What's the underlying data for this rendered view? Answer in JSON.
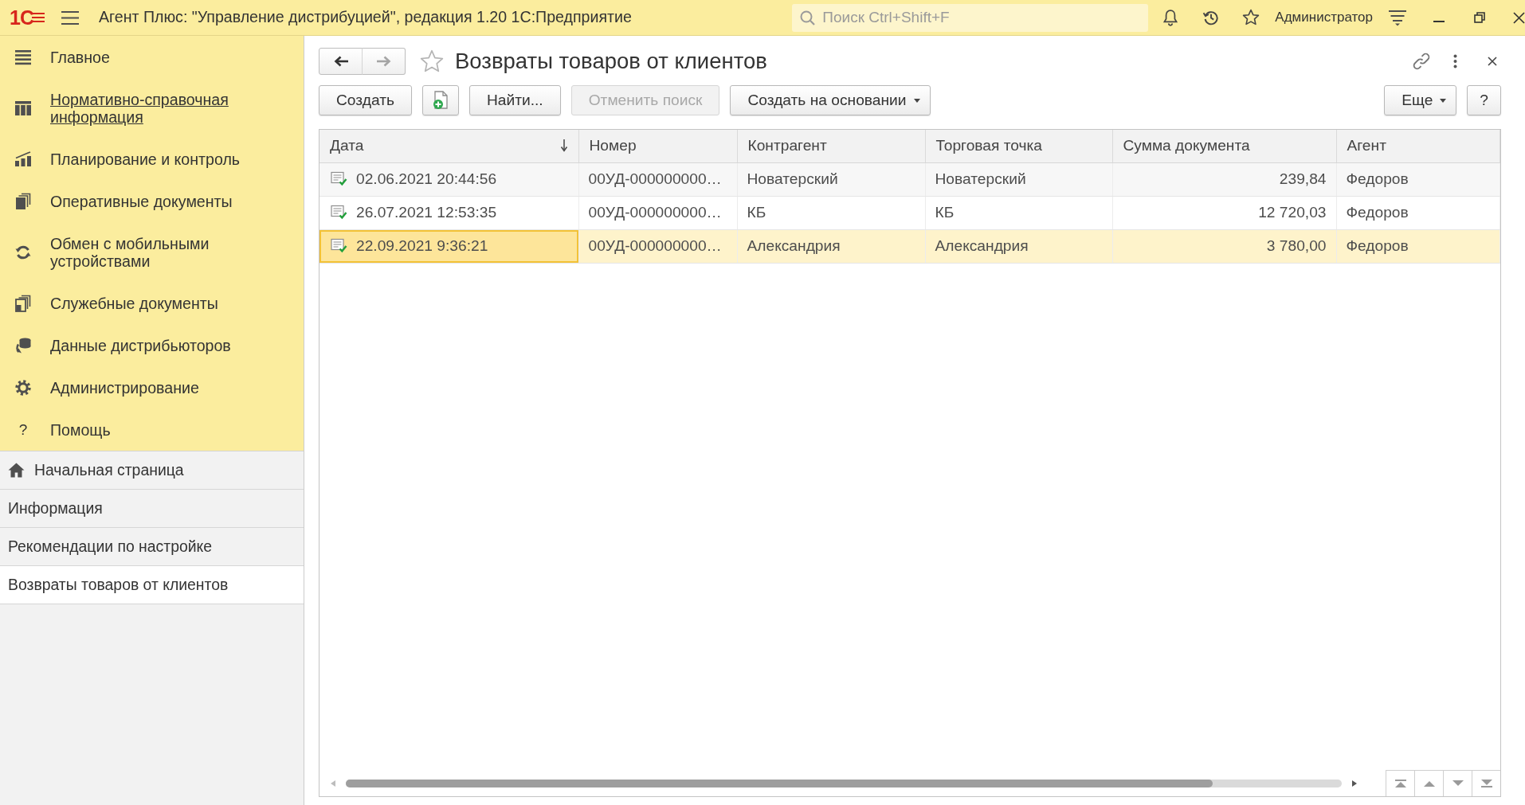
{
  "title_bar": {
    "logo": "1С",
    "title": "Агент Плюс: \"Управление дистрибуцией\", редакция 1.20 1С:Предприятие",
    "search": {
      "placeholder": "Поиск Ctrl+Shift+F"
    },
    "user": "Администратор"
  },
  "sections": [
    {
      "label": "Главное",
      "hovered": false
    },
    {
      "label": "Нормативно-справочная информация",
      "hovered": true
    },
    {
      "label": "Планирование и контроль",
      "hovered": false
    },
    {
      "label": "Оперативные документы",
      "hovered": false
    },
    {
      "label": "Обмен с мобильными устройствами",
      "hovered": false
    },
    {
      "label": "Служебные документы",
      "hovered": false
    },
    {
      "label": "Данные дистрибьюторов",
      "hovered": false
    },
    {
      "label": "Администрирование",
      "hovered": false
    },
    {
      "label": "Помощь",
      "hovered": false,
      "glyph": "?"
    }
  ],
  "open_windows": [
    {
      "kind": "home",
      "label": "Начальная страница",
      "selected": false
    },
    {
      "kind": "form",
      "label": "Информация",
      "selected": false
    },
    {
      "kind": "form",
      "label": "Рекомендации по настройке",
      "selected": false
    },
    {
      "kind": "form",
      "label": "Возвраты товаров от клиентов",
      "selected": true
    }
  ],
  "form": {
    "title": "Возвраты товаров от клиентов",
    "favorite": false,
    "history": [
      {
        "kind": "back",
        "disabled": false
      },
      {
        "kind": "forward",
        "disabled": true
      }
    ],
    "toolbar": [
      {
        "kind": "text",
        "label": "Создать",
        "disabled": false
      },
      {
        "kind": "icon",
        "disabled": false
      },
      {
        "kind": "text",
        "label": "Найти...",
        "disabled": false
      },
      {
        "kind": "text",
        "label": "Отменить поиск",
        "disabled": true
      },
      {
        "kind": "dropdown",
        "label": "Создать на основании",
        "disabled": false
      }
    ],
    "toolbar_right": [
      {
        "kind": "dropdown",
        "label": "Еще",
        "disabled": false
      },
      {
        "kind": "text",
        "label": "?",
        "disabled": false
      }
    ]
  },
  "table": {
    "columns": [
      {
        "label": "Дата",
        "kind": "text",
        "sorted": true
      },
      {
        "label": "Номер",
        "kind": "text",
        "sorted": false
      },
      {
        "label": "Контрагент",
        "kind": "text",
        "sorted": false
      },
      {
        "label": "Торговая точка",
        "kind": "text",
        "sorted": false
      },
      {
        "label": "Сумма документа",
        "kind": "number",
        "sorted": false
      },
      {
        "label": "Агент",
        "kind": "text",
        "sorted": false
      }
    ],
    "rows": [
      {
        "posted": true,
        "selected": false,
        "cells": [
          "02.06.2021 20:44:56",
          "00УД-000000000…",
          "Новатерский",
          "Новатерский",
          "239,84",
          "Федоров"
        ]
      },
      {
        "posted": true,
        "selected": false,
        "cells": [
          "26.07.2021 12:53:35",
          "00УД-000000000…",
          "КБ",
          "КБ",
          "12 720,03",
          "Федоров"
        ]
      },
      {
        "posted": true,
        "selected": true,
        "cells": [
          "22.09.2021 9:36:21",
          "00УД-000000000…",
          "Александрия",
          "Александрия",
          "3 780,00",
          "Федоров"
        ]
      }
    ]
  }
}
